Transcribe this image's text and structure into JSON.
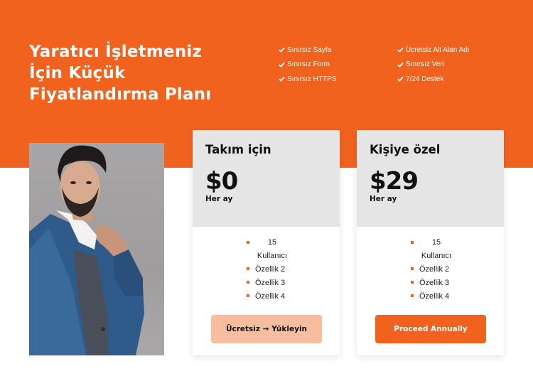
{
  "hero": {
    "title_lines": [
      "Yaratıcı İşletmeniz",
      "İçin Küçük",
      "Fiyatlandırma Planı"
    ]
  },
  "features": {
    "column1": [
      {
        "icon": "check-icon",
        "label": "Sınırsız Sayfa"
      },
      {
        "icon": "check-icon",
        "label": "Sınırsız Form"
      },
      {
        "icon": "check-icon",
        "label": "Sınırsız HTTPS"
      }
    ],
    "column2": [
      {
        "icon": "check-icon",
        "label": "Ücretsiz Alt Alan Adı"
      },
      {
        "icon": "check-icon",
        "label": "Sınırsız Veri"
      },
      {
        "icon": "check-icon",
        "label": "7/24 Destek"
      }
    ]
  },
  "photo": {
    "alt": "man in blue blazer"
  },
  "plans": [
    {
      "name": "Takım için",
      "price": "$0",
      "period": "Her ay",
      "features": [
        "15 Kullanıcı",
        "Özellik 2",
        "Özellik 3",
        "Özellik 4"
      ],
      "button_label": "Ücretsiz → Yükleyin"
    },
    {
      "name": "Kişiye özel",
      "price": "$29",
      "period": "Her ay",
      "features": [
        "15 Kullanıcı",
        "Özellik 2",
        "Özellik 3",
        "Özellik 4"
      ],
      "button_label": "Proceed Annually"
    }
  ],
  "colors": {
    "accent": "#f2621f",
    "accent_light": "#f8bc9f",
    "card_header": "#e5e5e5",
    "bullet": "#d8683a"
  }
}
